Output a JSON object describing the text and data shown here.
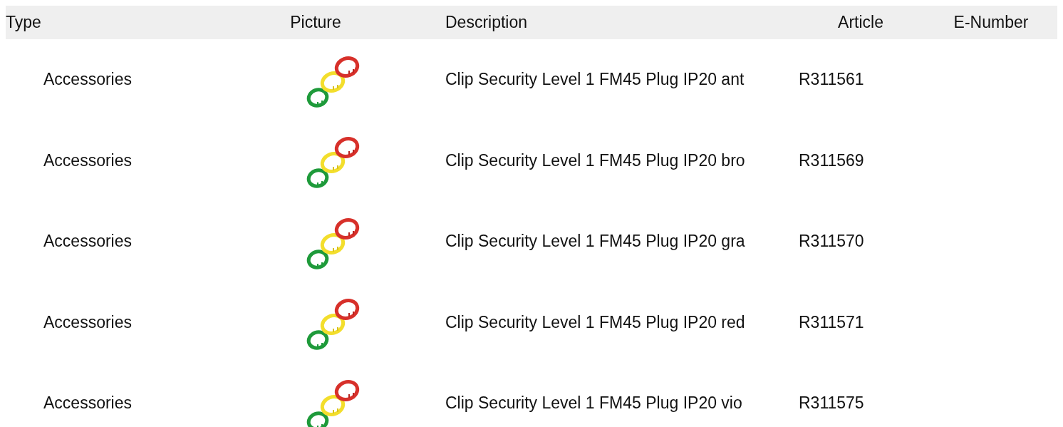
{
  "table": {
    "columns": [
      "Type",
      "Picture",
      "Description",
      "Article",
      "E-Number"
    ],
    "rows": [
      {
        "type": "Accessories",
        "description": "Clip Security Level 1 FM45 Plug IP20 ant",
        "article": "R311561"
      },
      {
        "type": "Accessories",
        "description": "Clip Security Level 1 FM45 Plug IP20 bro",
        "article": "R311569"
      },
      {
        "type": "Accessories",
        "description": "Clip Security Level 1 FM45 Plug IP20 gra",
        "article": "R311570"
      },
      {
        "type": "Accessories",
        "description": "Clip Security Level 1 FM45 Plug IP20 red",
        "article": "R311571"
      },
      {
        "type": "Accessories",
        "description": "Clip Security Level 1 FM45 Plug IP20 vio",
        "article": "R311575"
      }
    ]
  }
}
